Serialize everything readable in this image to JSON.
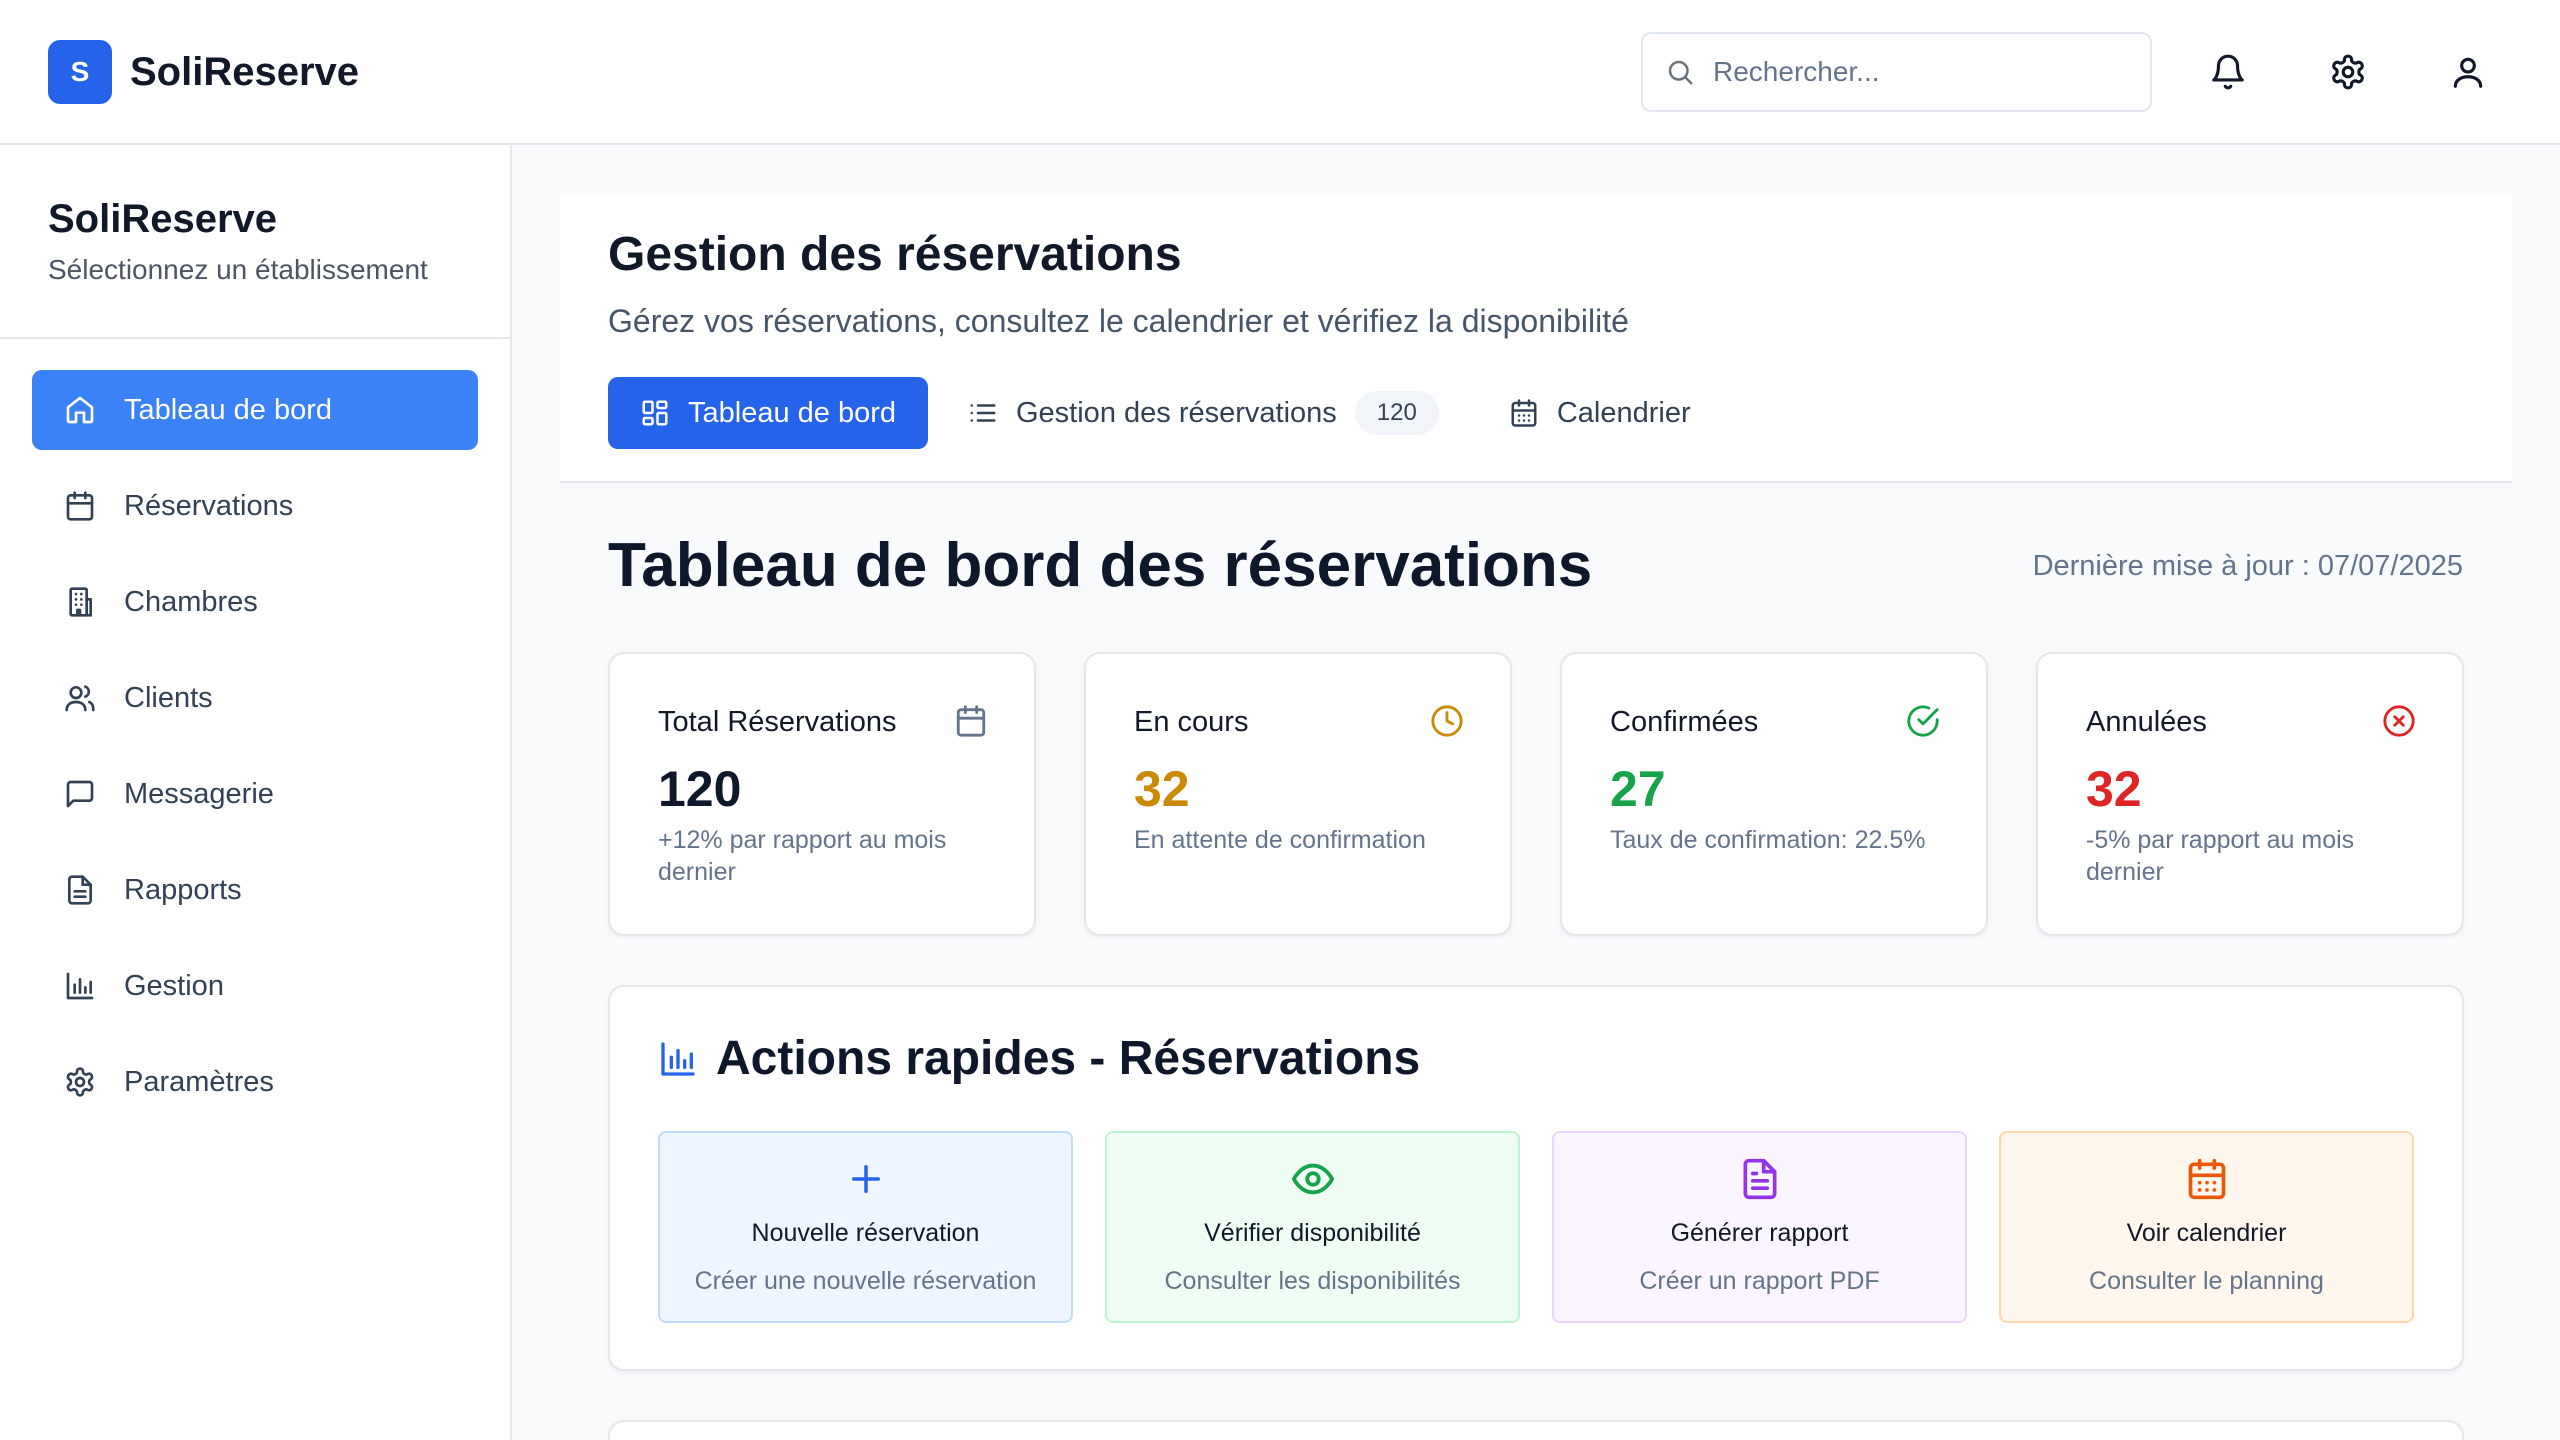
{
  "app": {
    "logo_letter": "S",
    "name": "SoliReserve"
  },
  "header": {
    "search_placeholder": "Rechercher...",
    "icons": [
      "bell-icon",
      "gear-icon",
      "user-icon"
    ]
  },
  "sidebar": {
    "title": "SoliReserve",
    "subtitle": "Sélectionnez un établissement",
    "items": [
      {
        "label": "Tableau de bord",
        "icon": "home-icon",
        "active": true
      },
      {
        "label": "Réservations",
        "icon": "calendar-icon"
      },
      {
        "label": "Chambres",
        "icon": "building-icon"
      },
      {
        "label": "Clients",
        "icon": "users-icon"
      },
      {
        "label": "Messagerie",
        "icon": "message-icon"
      },
      {
        "label": "Rapports",
        "icon": "file-icon"
      },
      {
        "label": "Gestion",
        "icon": "bar-chart-icon"
      },
      {
        "label": "Paramètres",
        "icon": "gear-icon"
      }
    ]
  },
  "page": {
    "title": "Gestion des réservations",
    "subtitle": "Gérez vos réservations, consultez le calendrier et vérifiez la disponibilité",
    "tabs": [
      {
        "label": "Tableau de bord",
        "icon": "grid-icon",
        "active": true
      },
      {
        "label": "Gestion des réservations",
        "icon": "list-icon",
        "badge": "120"
      },
      {
        "label": "Calendrier",
        "icon": "calendar-icon"
      }
    ]
  },
  "dashboard": {
    "title": "Tableau de bord des réservations",
    "last_update": "Dernière mise à jour : 07/07/2025",
    "stats": [
      {
        "label": "Total Réservations",
        "value": "120",
        "note": "+12% par rapport au mois dernier",
        "icon": "calendar-icon",
        "color": "#0f172a",
        "icon_color": "#64748b"
      },
      {
        "label": "En cours",
        "value": "32",
        "note": "En attente de confirmation",
        "icon": "clock-icon",
        "color": "#ca8a04",
        "icon_color": "#ca8a04"
      },
      {
        "label": "Confirmées",
        "value": "27",
        "note": "Taux de confirmation: 22.5%",
        "icon": "check-circle-icon",
        "color": "#16a34a",
        "icon_color": "#16a34a"
      },
      {
        "label": "Annulées",
        "value": "32",
        "note": "-5% par rapport au mois dernier",
        "icon": "x-circle-icon",
        "color": "#dc2626",
        "icon_color": "#dc2626"
      }
    ]
  },
  "quick_actions": {
    "title": "Actions rapides - Réservations",
    "icon": "bar-chart-icon",
    "items": [
      {
        "label": "Nouvelle réservation",
        "description": "Créer une nouvelle réservation",
        "icon": "plus-icon",
        "bg": "#eff6ff",
        "border": "#bfdbfe",
        "icon_color": "#2563eb"
      },
      {
        "label": "Vérifier disponibilité",
        "description": "Consulter les disponibilités",
        "icon": "eye-icon",
        "bg": "#f0fdf4",
        "border": "#bbf7d0",
        "icon_color": "#16a34a"
      },
      {
        "label": "Générer rapport",
        "description": "Créer un rapport PDF",
        "icon": "file-text-icon",
        "bg": "#faf5ff",
        "border": "#e9d5ff",
        "icon_color": "#9333ea"
      },
      {
        "label": "Voir calendrier",
        "description": "Consulter le planning",
        "icon": "calendar-days-icon",
        "bg": "#fff7ed",
        "border": "#fed7aa",
        "icon_color": "#ea580c"
      }
    ]
  }
}
